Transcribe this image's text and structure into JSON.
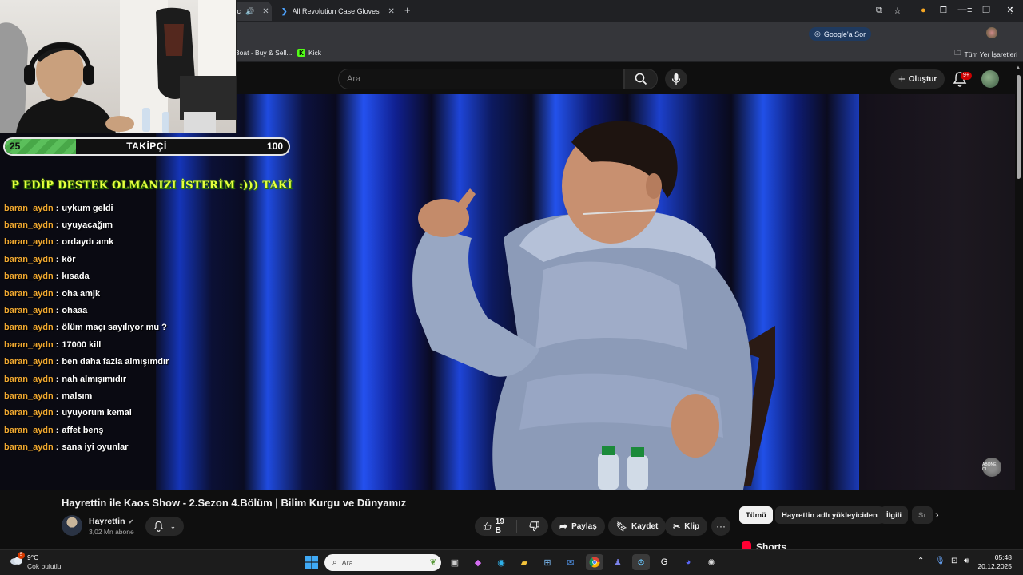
{
  "browser": {
    "tabs": [
      {
        "label": "Hayrettin ile Kaos Show - 2.Sezon 4.Bölüm | Bilim Kurgu ve Dünyamız",
        "visible_suffix": "ıc",
        "active": true
      },
      {
        "label": "All Revolution Case Gloves - Cs",
        "active": false
      }
    ],
    "new_tab_symbol": "+",
    "google_ask_label": "Google'a Sor",
    "bookmarks": [
      {
        "label": "Boat - Buy & Sell..."
      },
      {
        "label": "Kick"
      }
    ],
    "all_bookmarks_label": "Tüm Yer İşaretleri"
  },
  "youtube": {
    "search_placeholder": "Ara",
    "create_label": "Oluştur",
    "notification_count": "9+",
    "video_title": "Hayrettin ile Kaos Show - 2.Sezon 4.Bölüm | Bilim Kurgu ve Dünyamız",
    "channel_name": "Hayrettin",
    "channel_subs": "3,02 Mn abone",
    "like_count": "19 B",
    "share_label": "Paylaş",
    "save_label": "Kaydet",
    "clip_label": "Klip",
    "more_label": "···",
    "chips": [
      "Tümü",
      "Hayrettin adlı yükleyiciden",
      "İlgili",
      "Sı"
    ],
    "shorts_label": "Shorts",
    "mini_subscribe": "ABONE OL"
  },
  "stream_overlay": {
    "goal_start": "25",
    "goal_label": "TAKİPÇİ",
    "goal_end": "100",
    "goal_progress": 0.25,
    "marquee_text": "P EDİP DESTEK OLMANIZI İSTERİM :))) TAKİ",
    "chat": [
      {
        "user": "baran_aydn",
        "msg": "uykum geldi"
      },
      {
        "user": "baran_aydn",
        "msg": "uyuyacağım"
      },
      {
        "user": "baran_aydn",
        "msg": "ordaydı amk"
      },
      {
        "user": "baran_aydn",
        "msg": "kör"
      },
      {
        "user": "baran_aydn",
        "msg": "kısada"
      },
      {
        "user": "baran_aydn",
        "msg": "oha amjk"
      },
      {
        "user": "baran_aydn",
        "msg": "ohaaa"
      },
      {
        "user": "baran_aydn",
        "msg": "ölüm maçı sayılıyor mu ?"
      },
      {
        "user": "baran_aydn",
        "msg": "17000 kill"
      },
      {
        "user": "baran_aydn",
        "msg": "ben daha fazla almışımdır"
      },
      {
        "user": "baran_aydn",
        "msg": "nah almışımıdır"
      },
      {
        "user": "baran_aydn",
        "msg": "malsım"
      },
      {
        "user": "baran_aydn",
        "msg": "uyuyorum kemal"
      },
      {
        "user": "baran_aydn",
        "msg": "affet benş"
      },
      {
        "user": "baran_aydn",
        "msg": "sana iyi oyunlar"
      }
    ]
  },
  "taskbar": {
    "weather_temp": "9°C",
    "weather_desc": "Çok bulutlu",
    "weather_badge": "5",
    "search_placeholder": "Ara",
    "time": "05:48",
    "date": "20.12.2025"
  },
  "colors": {
    "chat_user": "#f0a830",
    "marquee": "#e7ff3f",
    "goal_fill": "#5bbf5b",
    "yt_bg": "#0f0f0f",
    "notif_red": "#cc0000"
  }
}
